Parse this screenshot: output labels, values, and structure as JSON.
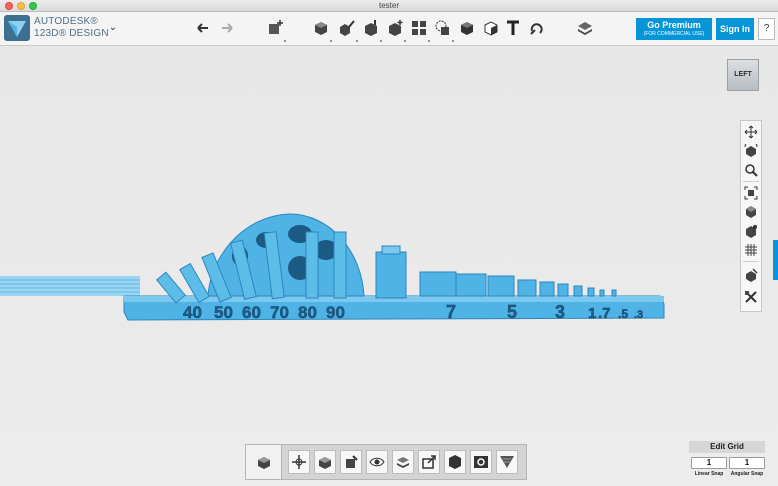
{
  "window": {
    "title": "tester"
  },
  "brand": {
    "line1": "AUTODESK®",
    "line2": "123D® DESIGN"
  },
  "toolbar": {
    "undo_icon": "undo-icon",
    "redo_icon": "redo-icon",
    "premium_label": "Go Premium",
    "premium_sub": "(FOR COMMERCIAL USE)",
    "signin_label": "Sign In",
    "help_label": "?"
  },
  "viewcube": {
    "label": "LEFT"
  },
  "model_labels": {
    "angles": [
      "40",
      "50",
      "60",
      "70",
      "80",
      "90"
    ],
    "sizes": [
      "7",
      "5",
      "3",
      "1",
      ".7",
      ".5",
      ".3"
    ]
  },
  "edit_grid": {
    "title": "Edit Grid",
    "linear_value": "1",
    "angular_value": "1",
    "linear_label": "Linear Snap",
    "angular_label": "Angular Snap"
  },
  "colors": {
    "accent": "#0696d7",
    "model": "#4fb3e6",
    "model_dark": "#2d86bb"
  }
}
